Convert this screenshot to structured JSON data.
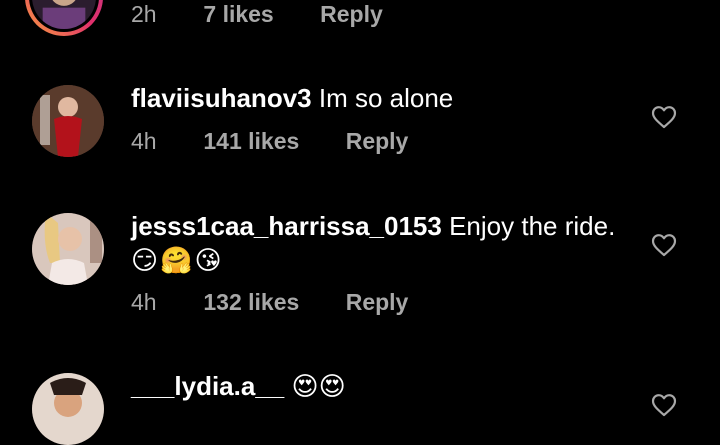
{
  "comments": [
    {
      "username": "",
      "text": "",
      "emojis": "",
      "time": "2h",
      "likes": "7 likes",
      "reply": "Reply"
    },
    {
      "username": "flaviisuhanov3",
      "text": "Im so alone",
      "emojis": "",
      "time": "4h",
      "likes": "141 likes",
      "reply": "Reply"
    },
    {
      "username": "jesss1caa_harrissa_0153",
      "text": "Enjoy the ride.",
      "emojis": "😏🤗😘",
      "time": "4h",
      "likes": "132 likes",
      "reply": "Reply"
    },
    {
      "username": "___lydia.a__",
      "text": "😍😍",
      "emojis": "",
      "time": "",
      "likes": "",
      "reply": ""
    }
  ],
  "colors": {
    "background": "#000000",
    "text": "#ffffff",
    "meta": "#a8a8a8"
  },
  "icons": {
    "like": "heart-outline-icon"
  }
}
